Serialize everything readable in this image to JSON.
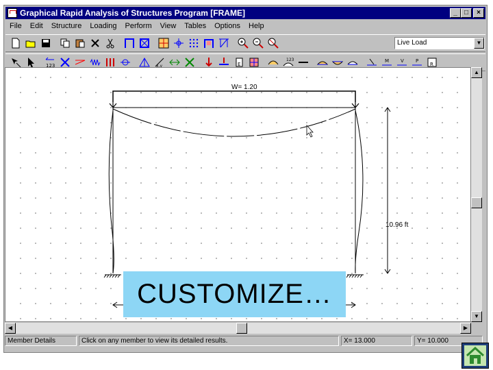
{
  "window": {
    "title": "Graphical Rapid Analysis of Structures Program [FRAME]",
    "buttons": {
      "minimize": "_",
      "maximize": "□",
      "close": "×"
    }
  },
  "menu": [
    "File",
    "Edit",
    "Structure",
    "Loading",
    "Perform",
    "View",
    "Tables",
    "Options",
    "Help"
  ],
  "toolbar": {
    "load_case": "Live Load",
    "row1_icons": [
      "new-icon",
      "open-icon",
      "save-icon",
      "copy-icon",
      "paste-icon",
      "delete-icon",
      "cut-icon",
      "frame-icon",
      "truss-icon",
      "grid-icon",
      "nodes-icon",
      "dots-icon",
      "members-icon",
      "supports-icon",
      "zoom-in-icon",
      "zoom-out-icon",
      "zoom-fit-icon"
    ],
    "row2_icons": [
      "select-icon",
      "pointer-icon",
      "number-icon",
      "cross-icon",
      "diagonal-icon",
      "spring-icon",
      "hinge-icon",
      "axis-icon",
      "measure-icon",
      "xy-icon",
      "translate-icon",
      "release-icon",
      "load-icon",
      "point-load-icon",
      "dist-load-icon",
      "section-icon",
      "area-icon",
      "deflection-icon",
      "values-icon",
      "line-icon",
      "shear-icon",
      "moment-icon",
      "axial-icon",
      "vert-icon",
      "m-icon",
      "v-icon",
      "p-icon",
      "reaction-icon"
    ],
    "row2_labels": {
      "n123": "123",
      "xy": "x,y",
      "e": "E",
      "v123": "123",
      "m": "M",
      "v": "V",
      "p": "P",
      "r": "R"
    }
  },
  "drawing": {
    "load_label": "W=  1.20",
    "height_label": "10.96 ft"
  },
  "status": {
    "member_details": "Member Details",
    "hint": "Click on any member to view its detailed results.",
    "x_coord": "X= 13.000",
    "y_coord": "Y= 10.000"
  },
  "overlay": {
    "customize": "CUSTOMIZE…"
  },
  "colors": {
    "titlebar": "#000080",
    "chrome": "#c0c0c0",
    "overlay": "#8dd6f5",
    "home_bg": "#1f3f7a",
    "home_house": "#2e8b2e"
  }
}
